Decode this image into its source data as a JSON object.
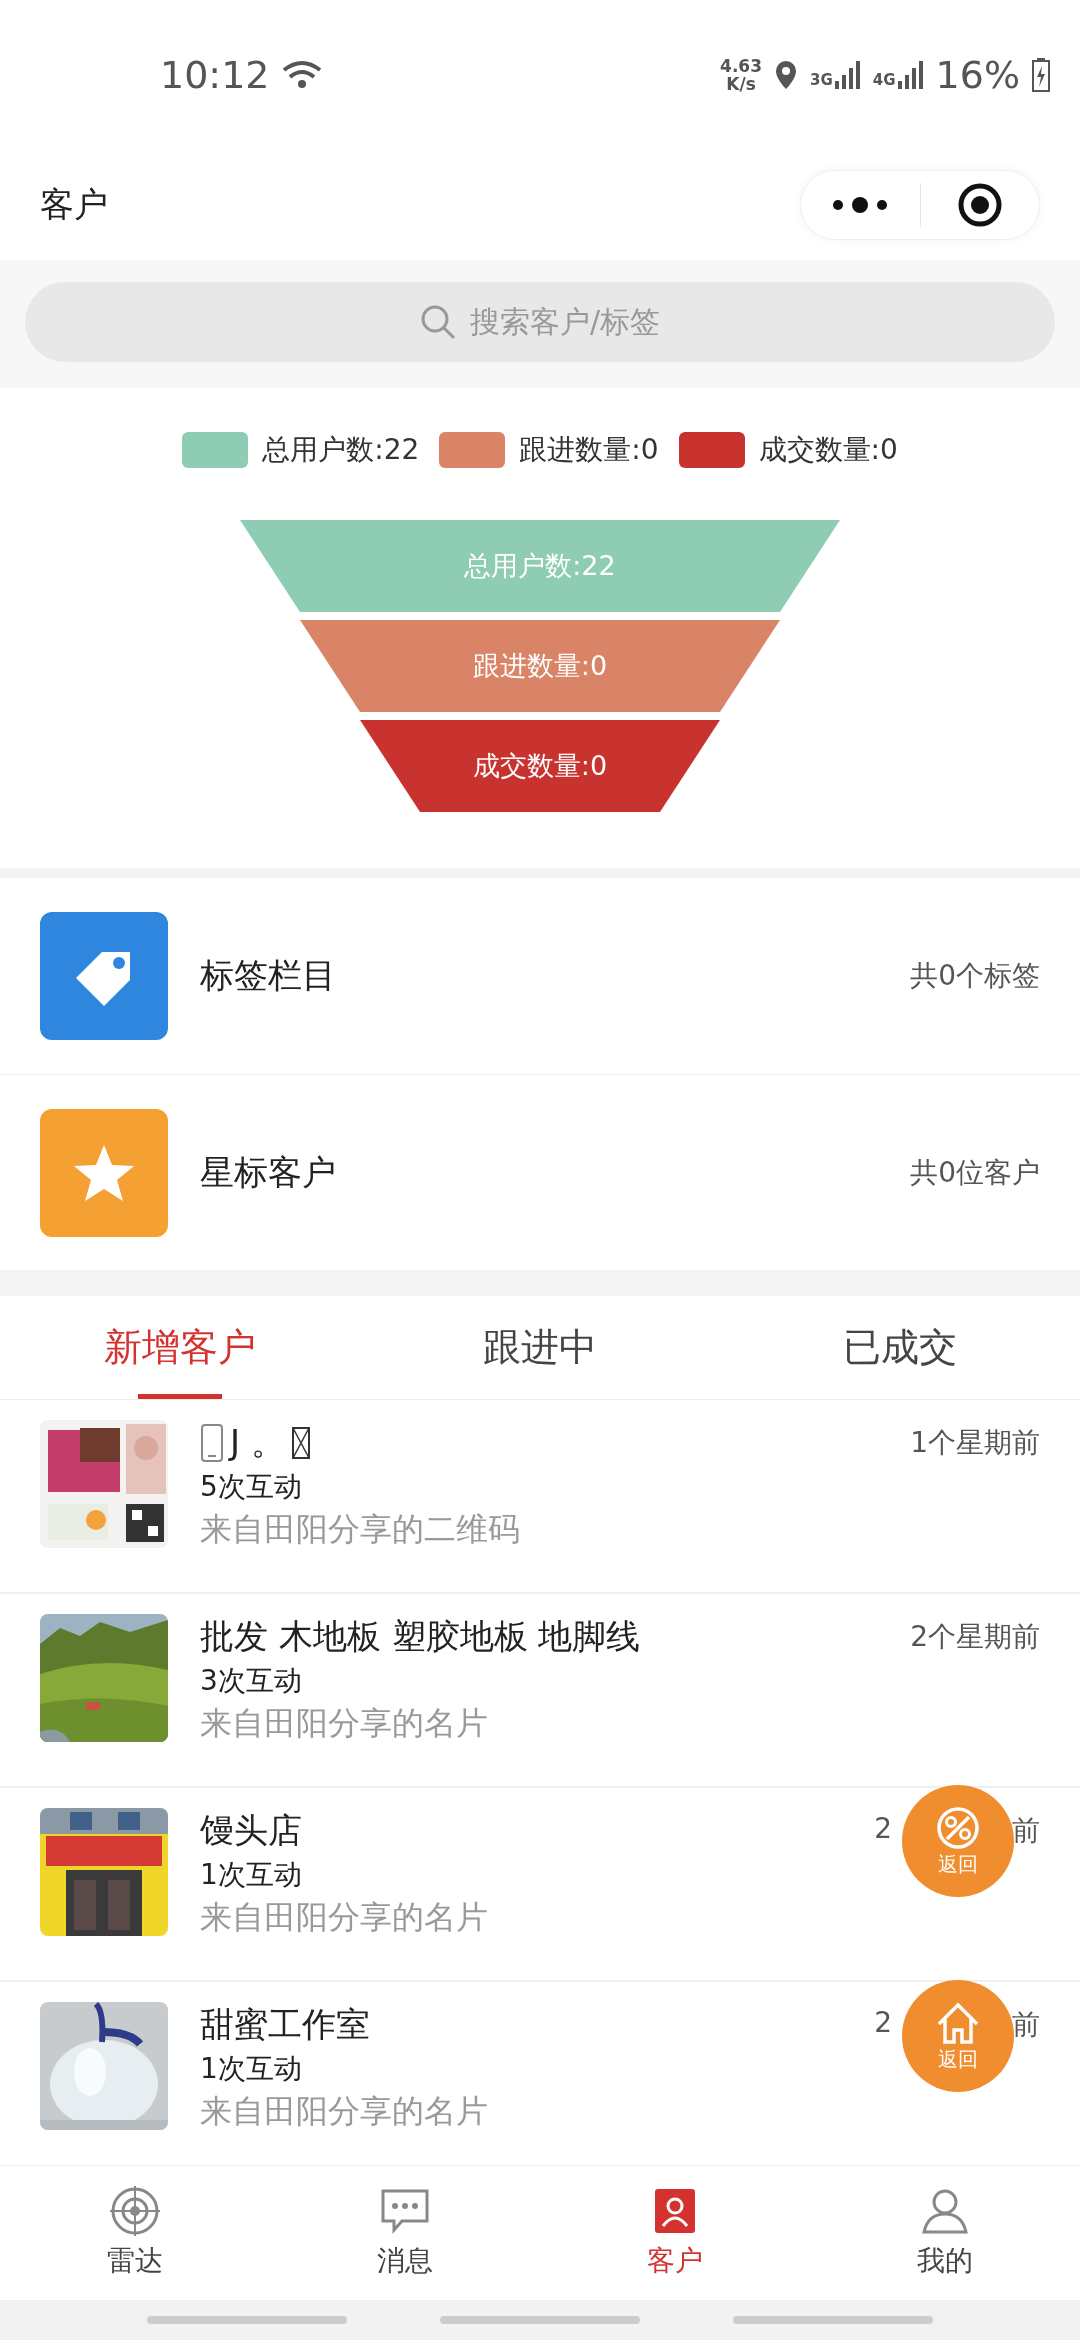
{
  "status_bar": {
    "time": "10:12",
    "net_speed": [
      "4.63",
      "K/s"
    ],
    "networks": [
      "3G",
      "4G"
    ],
    "battery": "16%"
  },
  "header": {
    "title": "客户"
  },
  "search": {
    "placeholder": "搜索客户/标签"
  },
  "legend": [
    {
      "label": "总用户数:22",
      "color": "#8ecdb4"
    },
    {
      "label": "跟进数量:0",
      "color": "#d98466"
    },
    {
      "label": "成交数量:0",
      "color": "#c8322f"
    }
  ],
  "funnel": [
    {
      "label": "总用户数:22",
      "color": "#8ecdb4"
    },
    {
      "label": "跟进数量:0",
      "color": "#d98466"
    },
    {
      "label": "成交数量:0",
      "color": "#c8322f"
    }
  ],
  "menu": [
    {
      "kind": "tag",
      "title": "标签栏目",
      "count": "共0个标签"
    },
    {
      "kind": "star",
      "title": "星标客户",
      "count": "共0位客户"
    }
  ],
  "tabs": [
    {
      "label": "新增客户",
      "selected": true
    },
    {
      "label": "跟进中",
      "selected": false
    },
    {
      "label": "已成交",
      "selected": false
    }
  ],
  "customers": [
    {
      "name": "J 。",
      "phone_icon": true,
      "missing_glyph": true,
      "interactions": "5次互动",
      "source": "来自田阳分享的二维码",
      "time": "1个星期前",
      "kind": "picture"
    },
    {
      "name": "批发 木地板 塑胶地板 地脚线",
      "interactions": "3次互动",
      "source": "来自田阳分享的名片",
      "time": "2个星期前",
      "kind": "picture"
    },
    {
      "name": "馒头店",
      "interactions": "1次互动",
      "source": "来自田阳分享的名片",
      "time_parts": [
        "2",
        "前"
      ],
      "kind": "picture"
    },
    {
      "name": "甜蜜工作室",
      "interactions": "1次互动",
      "source": "来自田阳分享的名片",
      "time_parts": [
        "2",
        "前"
      ],
      "kind": "picture"
    }
  ],
  "floating_buttons": [
    {
      "kind": "discount",
      "label": "返回"
    },
    {
      "kind": "home",
      "label": "返回"
    }
  ],
  "nav": [
    {
      "kind": "radar",
      "label": "雷达",
      "selected": false
    },
    {
      "kind": "message",
      "label": "消息",
      "selected": false
    },
    {
      "kind": "customer",
      "label": "客户",
      "selected": true
    },
    {
      "kind": "profile",
      "label": "我的",
      "selected": false
    }
  ]
}
